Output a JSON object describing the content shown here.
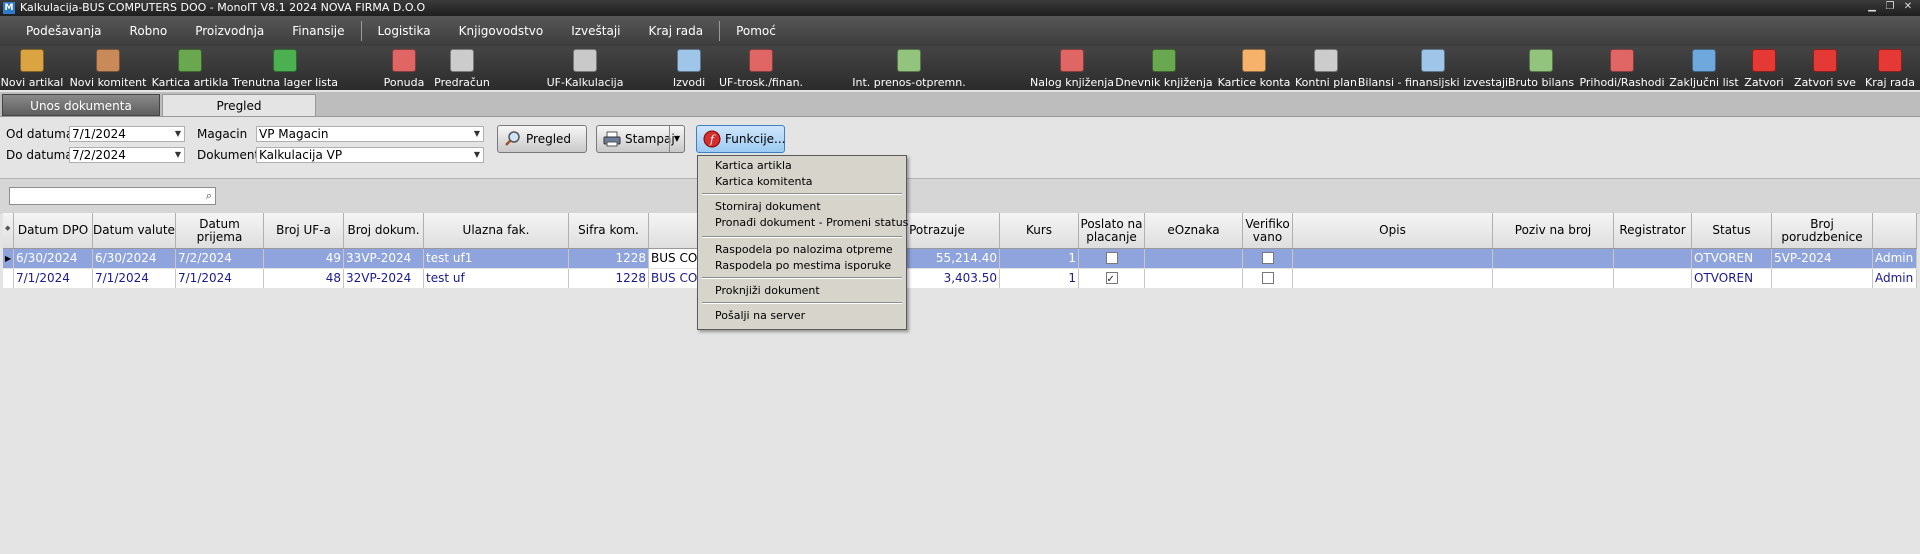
{
  "window": {
    "title": "Kalkulacija-BUS COMPUTERS DOO - MonoIT V8.1 2024 NOVA FIRMA D.O.O",
    "app_icon": "M"
  },
  "menu": [
    "Podešavanja",
    "Robno",
    "Proizvodnja",
    "Finansije",
    "Logistika",
    "Knjigovodstvo",
    "Izveštaji",
    "Kraj rada",
    "Pomoć"
  ],
  "toolbar": [
    {
      "label": "Novi artikal",
      "icon": "new-item-icon",
      "color": "#d9a441"
    },
    {
      "label": "Novi komitent",
      "icon": "new-client-icon",
      "color": "#c98a5a"
    },
    {
      "label": "Kartica artikla",
      "icon": "item-card-icon",
      "color": "#6aa84f"
    },
    {
      "label": "Trenutna lager lista",
      "icon": "stock-list-icon",
      "color": "#4caf50"
    },
    {
      "label": "Ponuda",
      "icon": "offer-icon",
      "color": "#e06666"
    },
    {
      "label": "Predračun",
      "icon": "proforma-icon",
      "color": "#cccccc"
    },
    {
      "label": "UF-Kalkulacija",
      "icon": "calculation-icon",
      "color": "#c9c9c9"
    },
    {
      "label": "Izvodi",
      "icon": "statements-icon",
      "color": "#9fc5e8"
    },
    {
      "label": "UF-trosk./finan.",
      "icon": "costs-icon",
      "color": "#e06666"
    },
    {
      "label": "Int. prenos-otpremn.",
      "icon": "transfer-icon",
      "color": "#93c47d"
    },
    {
      "label": "Nalog knjiženja",
      "icon": "posting-order-icon",
      "color": "#e06666"
    },
    {
      "label": "Dnevnik knjiženja",
      "icon": "journal-icon",
      "color": "#6aa84f"
    },
    {
      "label": "Kartice konta",
      "icon": "account-cards-icon",
      "color": "#f6b26b"
    },
    {
      "label": "Kontni plan",
      "icon": "chart-of-accounts-icon",
      "color": "#cccccc"
    },
    {
      "label": "Bilansi - finansijski izvestaji",
      "icon": "balance-icon",
      "color": "#9fc5e8"
    },
    {
      "label": "Bruto bilans",
      "icon": "gross-balance-icon",
      "color": "#93c47d"
    },
    {
      "label": "Prihodi/Rashodi",
      "icon": "income-expense-icon",
      "color": "#e06666"
    },
    {
      "label": "Zaključni list",
      "icon": "closing-sheet-icon",
      "color": "#6fa8dc"
    },
    {
      "label": "Zatvori",
      "icon": "close-icon",
      "color": "#e53935"
    },
    {
      "label": "Zatvori sve",
      "icon": "close-all-icon",
      "color": "#e53935"
    },
    {
      "label": "Kraj rada",
      "icon": "power-icon",
      "color": "#e53935"
    }
  ],
  "tabs": {
    "entry": "Unos dokumenta",
    "review": "Pregled"
  },
  "filters": {
    "from_label": "Od datuma",
    "from_value": "7/1/2024",
    "to_label": "Do datuma",
    "to_value": "7/2/2024",
    "warehouse_label": "Magacin",
    "warehouse_value": "VP Magacin",
    "document_label": "Dokument",
    "document_value": "Kalkulacija VP"
  },
  "buttons": {
    "review": "Pregled",
    "print": "Stampaj",
    "functions": "Funkcije..."
  },
  "search": {
    "placeholder": ""
  },
  "columns": [
    "",
    "Datum DPO",
    "Datum valute",
    "Datum prijema",
    "Broj UF-a",
    "Broj dokum.",
    "Ulazna fak.",
    "Sifra kom.",
    "",
    "",
    "Potrazuje",
    "Kurs",
    "Poslato na placanje",
    "eOznaka",
    "Verifiko vano",
    "Opis",
    "Poziv na broj",
    "Registrator",
    "Status",
    "Broj porudzbenice",
    ""
  ],
  "rows": [
    {
      "selected": true,
      "dpo": "6/30/2024",
      "valuta": "6/30/2024",
      "prijem": "7/2/2024",
      "broj_uf": "49",
      "broj_dok": "33VP-2024",
      "ulazna": "test uf1",
      "sifra": "1228",
      "naziv": "BUS COM",
      "potrazuje": "55,214.40",
      "kurs": "1",
      "poslato": false,
      "verifikovano": false,
      "status": "OTVOREN",
      "porudzbenica": "5VP-2024",
      "user": "Admin"
    },
    {
      "selected": false,
      "dpo": "7/1/2024",
      "valuta": "7/1/2024",
      "prijem": "7/1/2024",
      "broj_uf": "48",
      "broj_dok": "32VP-2024",
      "ulazna": "test uf",
      "sifra": "1228",
      "naziv": "BUS CON",
      "potrazuje": "3,403.50",
      "kurs": "1",
      "poslato": true,
      "verifikovano": false,
      "status": "OTVOREN",
      "porudzbenica": "",
      "user": "Admin"
    }
  ],
  "functions_menu": [
    [
      "Kartica artikla",
      "Kartica komitenta"
    ],
    [
      "Storniraj dokument",
      "Pronađi dokument - Promeni status"
    ],
    [
      "Raspodela po nalozima otpreme",
      "Raspodela po mestima isporuke"
    ],
    [
      "Proknjiži dokument"
    ],
    [
      "Pošalji na server"
    ]
  ]
}
